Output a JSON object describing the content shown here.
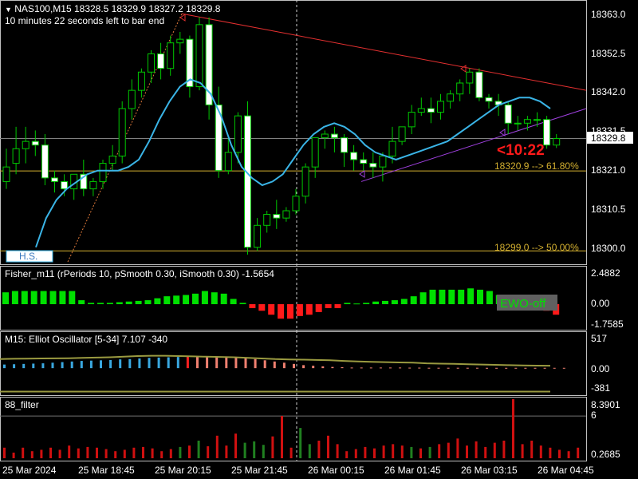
{
  "header": {
    "symbol_line": "NAS100,M15  18328.5 18329.9 18327.2 18329.8",
    "countdown_line": "10 minutes 22 seconds left to bar end"
  },
  "price_panel": {
    "price_axis_labels": [
      "18363.0",
      "18352.5",
      "18342.0",
      "18331.5",
      "18321.0",
      "18310.5",
      "18300.0"
    ],
    "current_price_label": "18329.8",
    "timer_label": "<10:22",
    "fib_labels": [
      "18320.9 --> 61.80%",
      "18299.0 --> 50.00%"
    ],
    "hs_label": "H.S."
  },
  "fisher_panel": {
    "title": "Fisher_m11  (rPeriods 10, pSmooth 0.30, iSmooth 0.30)   -1.5654",
    "axis_labels": [
      "2.4882",
      "0.00",
      "-1.7585"
    ],
    "ewo_badge": "EWO-off"
  },
  "elliot_panel": {
    "title": "M15: Elliot Oscillator [5-34]  7.107 -340",
    "axis_labels": [
      "517",
      "0.00",
      "-381"
    ]
  },
  "filter_panel": {
    "title": "88_filter",
    "axis_labels": [
      "8.3901",
      "6",
      "0.2685"
    ]
  },
  "time_axis": [
    "25 Mar 2024",
    "25 Mar 18:45",
    "25 Mar 20:15",
    "25 Mar 21:45",
    "26 Mar 00:15",
    "26 Mar 01:45",
    "26 Mar 03:15",
    "26 Mar 04:45"
  ],
  "colors": {
    "bull_candle": "#ffffff",
    "bear_candle": "#ffffff",
    "wick": "#00c800",
    "ma": "#3ab4e6",
    "resistance": "#e53030",
    "support": "#a040e0",
    "fib": "#d4b030",
    "fisher_pos": "#00e000",
    "fisher_neg": "#ff1a1a",
    "elliot_blue": "#3aa8e0",
    "elliot_red": "#ff2020",
    "elliot_salmon": "#f08070",
    "elliot_signal": "#9a9a40",
    "filter_red": "#d01010",
    "filter_green": "#208020"
  },
  "chart_data": [
    {
      "type": "candlestick",
      "symbol": "NAS100",
      "timeframe": "M15",
      "ylim": [
        18296,
        18366
      ],
      "candles": [
        {
          "o": 18318,
          "h": 18327,
          "c": 18322,
          "l": 18316
        },
        {
          "o": 18323,
          "h": 18333,
          "c": 18327,
          "l": 18320
        },
        {
          "o": 18327,
          "h": 18333,
          "c": 18329,
          "l": 18323
        },
        {
          "o": 18329,
          "h": 18332,
          "c": 18328,
          "l": 18325
        },
        {
          "o": 18328,
          "h": 18331,
          "c": 18319,
          "l": 18317
        },
        {
          "o": 18319,
          "h": 18321,
          "c": 18318,
          "l": 18315
        },
        {
          "o": 18318,
          "h": 18320,
          "c": 18316,
          "l": 18314
        },
        {
          "o": 18316,
          "h": 18320,
          "c": 18320,
          "l": 18313
        },
        {
          "o": 18320,
          "h": 18324,
          "c": 18316,
          "l": 18314
        },
        {
          "o": 18316,
          "h": 18319,
          "c": 18318,
          "l": 18314
        },
        {
          "o": 18318,
          "h": 18324,
          "c": 18323,
          "l": 18316
        },
        {
          "o": 18323,
          "h": 18328,
          "c": 18325,
          "l": 18321
        },
        {
          "o": 18325,
          "h": 18340,
          "c": 18338,
          "l": 18323
        },
        {
          "o": 18338,
          "h": 18346,
          "c": 18343,
          "l": 18335
        },
        {
          "o": 18343,
          "h": 18349,
          "c": 18348,
          "l": 18341
        },
        {
          "o": 18348,
          "h": 18354,
          "c": 18353,
          "l": 18345
        },
        {
          "o": 18353,
          "h": 18356,
          "c": 18349,
          "l": 18346
        },
        {
          "o": 18349,
          "h": 18358,
          "c": 18356,
          "l": 18347
        },
        {
          "o": 18356,
          "h": 18359,
          "c": 18357,
          "l": 18353
        },
        {
          "o": 18357,
          "h": 18358,
          "c": 18344,
          "l": 18341
        },
        {
          "o": 18344,
          "h": 18363,
          "c": 18361,
          "l": 18343
        },
        {
          "o": 18361,
          "h": 18363,
          "c": 18339,
          "l": 18335
        },
        {
          "o": 18339,
          "h": 18344,
          "c": 18321,
          "l": 18319
        },
        {
          "o": 18321,
          "h": 18330,
          "c": 18326,
          "l": 18320
        },
        {
          "o": 18326,
          "h": 18337,
          "c": 18336,
          "l": 18323
        },
        {
          "o": 18336,
          "h": 18340,
          "c": 18300,
          "l": 18298
        },
        {
          "o": 18300,
          "h": 18308,
          "c": 18306,
          "l": 18299
        },
        {
          "o": 18306,
          "h": 18310,
          "c": 18309,
          "l": 18304
        },
        {
          "o": 18309,
          "h": 18313,
          "c": 18308,
          "l": 18305
        },
        {
          "o": 18308,
          "h": 18311,
          "c": 18310,
          "l": 18307
        },
        {
          "o": 18310,
          "h": 18316,
          "c": 18314,
          "l": 18309
        },
        {
          "o": 18314,
          "h": 18323,
          "c": 18322,
          "l": 18312
        },
        {
          "o": 18322,
          "h": 18330,
          "c": 18330,
          "l": 18319
        },
        {
          "o": 18330,
          "h": 18332,
          "c": 18331,
          "l": 18327
        },
        {
          "o": 18331,
          "h": 18333,
          "c": 18330,
          "l": 18326
        },
        {
          "o": 18330,
          "h": 18331,
          "c": 18326,
          "l": 18322
        },
        {
          "o": 18326,
          "h": 18328,
          "c": 18324,
          "l": 18321
        },
        {
          "o": 18324,
          "h": 18326,
          "c": 18323,
          "l": 18321
        },
        {
          "o": 18323,
          "h": 18326,
          "c": 18322,
          "l": 18319
        },
        {
          "o": 18322,
          "h": 18326,
          "c": 18325,
          "l": 18318
        },
        {
          "o": 18325,
          "h": 18333,
          "c": 18329,
          "l": 18323
        },
        {
          "o": 18329,
          "h": 18332,
          "c": 18333,
          "l": 18328
        },
        {
          "o": 18333,
          "h": 18339,
          "c": 18337,
          "l": 18331
        },
        {
          "o": 18337,
          "h": 18341,
          "c": 18338,
          "l": 18336
        },
        {
          "o": 18338,
          "h": 18341,
          "c": 18337,
          "l": 18334
        },
        {
          "o": 18337,
          "h": 18342,
          "c": 18340,
          "l": 18335
        },
        {
          "o": 18340,
          "h": 18343,
          "c": 18342,
          "l": 18338
        },
        {
          "o": 18342,
          "h": 18346,
          "c": 18345,
          "l": 18340
        },
        {
          "o": 18345,
          "h": 18349,
          "c": 18348,
          "l": 18342
        },
        {
          "o": 18348,
          "h": 18349,
          "c": 18341,
          "l": 18340
        },
        {
          "o": 18341,
          "h": 18342,
          "c": 18340,
          "l": 18338
        },
        {
          "o": 18340,
          "h": 18342,
          "c": 18339,
          "l": 18336
        },
        {
          "o": 18339,
          "h": 18340,
          "c": 18334,
          "l": 18331
        },
        {
          "o": 18334,
          "h": 18336,
          "c": 18334,
          "l": 18332
        },
        {
          "o": 18334,
          "h": 18336,
          "c": 18335,
          "l": 18332
        },
        {
          "o": 18335,
          "h": 18337,
          "c": 18335,
          "l": 18333
        },
        {
          "o": 18335,
          "h": 18336,
          "c": 18328,
          "l": 18327
        },
        {
          "o": 18328,
          "h": 18331,
          "c": 18329.8,
          "l": 18327.2
        }
      ],
      "series": [
        {
          "type": "line",
          "values": [
            18300,
            18308,
            18313,
            18316,
            18318,
            18320,
            18321,
            18321,
            18321,
            18322,
            18324,
            18329,
            18335,
            18340,
            18344,
            18346,
            18345,
            18342,
            18336,
            18328,
            18322,
            18319,
            18317,
            18318,
            18320,
            18324,
            18328,
            18331,
            18333,
            18334,
            18333,
            18331,
            18328,
            18326,
            18325,
            18324,
            18325,
            18326,
            18327,
            18328,
            18329,
            18331,
            18333,
            18335,
            18337,
            18339,
            18340,
            18341,
            18341,
            18340,
            18338
          ]
        }
      ],
      "levels": [
        {
          "price": 18320.9,
          "label": "18320.9 --> 61.80%"
        },
        {
          "price": 18299.0,
          "label": "18299.0 --> 50.00%"
        },
        {
          "price": 18329.8,
          "label": "current"
        }
      ]
    },
    {
      "type": "bar",
      "name": "Fisher_m11",
      "ylim": [
        -1.7585,
        2.4882
      ],
      "values": [
        0.9,
        1.0,
        1.0,
        1.0,
        1.0,
        1.0,
        1.0,
        1.0,
        0.3,
        0.1,
        0.1,
        0.1,
        0.15,
        0.2,
        0.25,
        0.3,
        0.45,
        0.6,
        0.65,
        0.7,
        0.8,
        1.0,
        0.9,
        0.8,
        0.4,
        0.1,
        -0.3,
        -0.5,
        -0.8,
        -1.1,
        -1.1,
        -0.9,
        -0.8,
        -0.6,
        -0.3,
        -0.3,
        0.1,
        0.05,
        0.1,
        0.2,
        0.25,
        0.3,
        0.4,
        0.6,
        0.9,
        1.1,
        1.1,
        1.1,
        1.1,
        1.2,
        1.1,
        1.0,
        0.7,
        0.3,
        0.2,
        -0.4,
        -0.4,
        -0.5,
        -0.8
      ]
    },
    {
      "type": "bar",
      "name": "Elliot Oscillator",
      "ylim": [
        -381,
        517
      ],
      "values": [
        60,
        65,
        70,
        75,
        80,
        90,
        100,
        110,
        120,
        125,
        130,
        135,
        145,
        150,
        160,
        170,
        175,
        180,
        185,
        190,
        200,
        200,
        195,
        190,
        180,
        170,
        150,
        130,
        110,
        90,
        70,
        50,
        40,
        30,
        20,
        15,
        10,
        10,
        10,
        10,
        10,
        10,
        8,
        8,
        6,
        6,
        6,
        6,
        6,
        6,
        5,
        5,
        5,
        5,
        5,
        5,
        5,
        5,
        5
      ],
      "signal": [
        150,
        155,
        158,
        160,
        162,
        165,
        170,
        175,
        180,
        190,
        200,
        205,
        205,
        200,
        195,
        190,
        185,
        180,
        170,
        160,
        150,
        145,
        140,
        135,
        130,
        120,
        110,
        105,
        100,
        95,
        90,
        80,
        75,
        70,
        65,
        60,
        55,
        50,
        45,
        42,
        40
      ]
    },
    {
      "type": "bar",
      "name": "88_filter",
      "ylim": [
        0.2685,
        8.3901
      ],
      "values": [
        1.5,
        0.8,
        1.5,
        1.0,
        1.2,
        1.5,
        1.2,
        1.8,
        1.4,
        1.6,
        1.5,
        1.3,
        1.0,
        1.2,
        1.5,
        1.6,
        1.4,
        1.0,
        1.3,
        1.6,
        1.8,
        2.5,
        1.7,
        3.2,
        1.8,
        3.5,
        2.2,
        2.4,
        1.9,
        3.1,
        6.0,
        1.5,
        4.3,
        2.0,
        2.5,
        3.2,
        2.0,
        1.0,
        1.3,
        1.6,
        1.4,
        1.8,
        2.0,
        1.8,
        1.6,
        1.4,
        1.6,
        2.0,
        2.2,
        2.8,
        1.8,
        2.4,
        1.6,
        2.2,
        2.5,
        8.3901,
        2.0,
        2.5,
        1.8,
        1.5,
        1.2,
        1.0,
        1.5
      ]
    }
  ]
}
